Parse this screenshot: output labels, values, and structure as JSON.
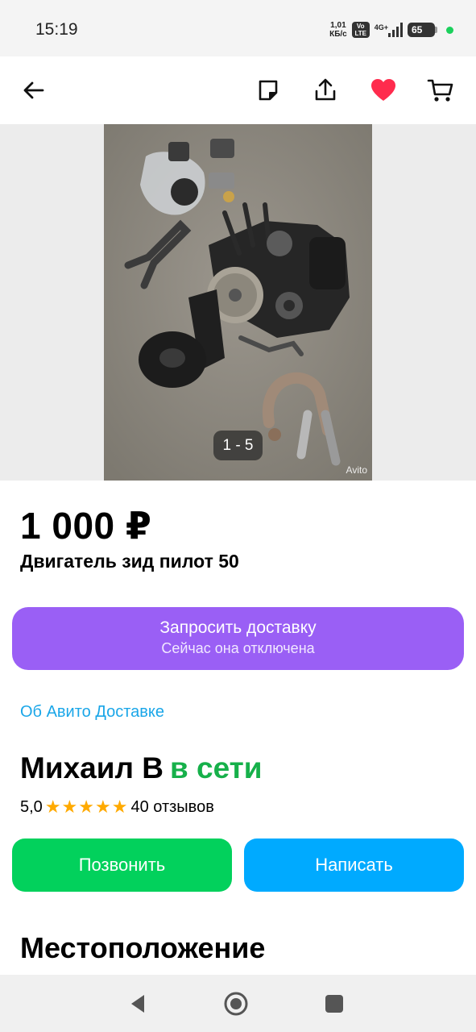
{
  "status_bar": {
    "time": "15:19",
    "net_speed_value": "1,01",
    "net_speed_unit": "КБ/с",
    "volte_top": "Vo",
    "volte_bottom": "LTE",
    "network": "4G+",
    "battery": "65",
    "dot_color": "#1bd05c"
  },
  "toolbar": {
    "back_icon": "arrow-left-icon",
    "note_icon": "note-icon",
    "share_icon": "share-icon",
    "favorite_icon": "heart-icon",
    "favorite_color": "#ff2b4d",
    "cart_icon": "cart-icon"
  },
  "gallery": {
    "counter": "1 - 5",
    "watermark": "Avito"
  },
  "listing": {
    "price": "1 000 ₽",
    "title": "Двигатель зид пилот 50"
  },
  "delivery": {
    "button_label": "Запросить доставку",
    "button_sublabel": "Сейчас она отключена",
    "about_link": "Об Авито Доставке",
    "accent_color": "#9a5ff5"
  },
  "seller": {
    "name": "Михаил В",
    "online_status": "в сети",
    "rating_value": "5,0",
    "stars": 5,
    "reviews": "40 отзывов"
  },
  "actions": {
    "call_label": "Позвонить",
    "write_label": "Написать",
    "call_color": "#02d15c",
    "write_color": "#00aaff"
  },
  "location": {
    "section_title": "Местоположение"
  },
  "nav_bar": {
    "back_icon": "triangle-back-icon",
    "home_icon": "circle-home-icon",
    "recents_icon": "square-recents-icon"
  }
}
